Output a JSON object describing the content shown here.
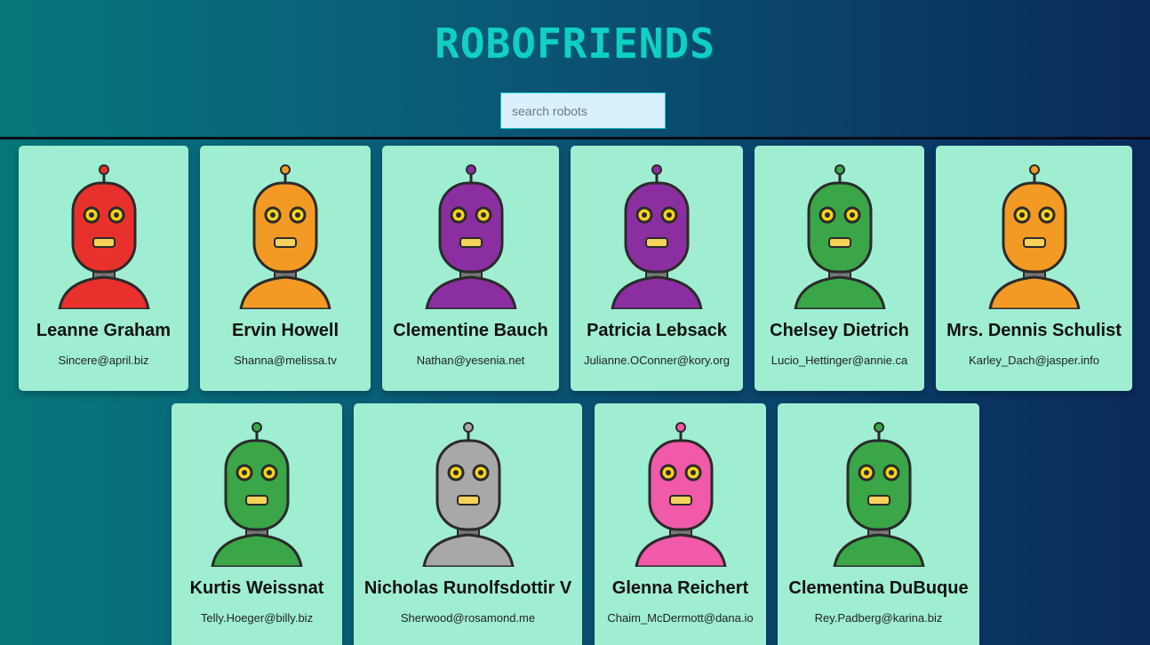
{
  "app": {
    "title": "ROBOFRIENDS",
    "search": {
      "placeholder": "search robots",
      "value": ""
    }
  },
  "robots": [
    {
      "name": "Leanne Graham",
      "email": "Sincere@april.biz",
      "color": "#e8312c"
    },
    {
      "name": "Ervin Howell",
      "email": "Shanna@melissa.tv",
      "color": "#f39a24"
    },
    {
      "name": "Clementine Bauch",
      "email": "Nathan@yesenia.net",
      "color": "#8b2fa0"
    },
    {
      "name": "Patricia Lebsack",
      "email": "Julianne.OConner@kory.org",
      "color": "#8b2fa0"
    },
    {
      "name": "Chelsey Dietrich",
      "email": "Lucio_Hettinger@annie.ca",
      "color": "#3aa647"
    },
    {
      "name": "Mrs. Dennis Schulist",
      "email": "Karley_Dach@jasper.info",
      "color": "#f39a24"
    },
    {
      "name": "Kurtis Weissnat",
      "email": "Telly.Hoeger@billy.biz",
      "color": "#3aa647"
    },
    {
      "name": "Nicholas Runolfsdottir V",
      "email": "Sherwood@rosamond.me",
      "color": "#a8a8a8"
    },
    {
      "name": "Glenna Reichert",
      "email": "Chaim_McDermott@dana.io",
      "color": "#f05aa8"
    },
    {
      "name": "Clementina DuBuque",
      "email": "Rey.Padberg@karina.biz",
      "color": "#3aa647"
    }
  ]
}
